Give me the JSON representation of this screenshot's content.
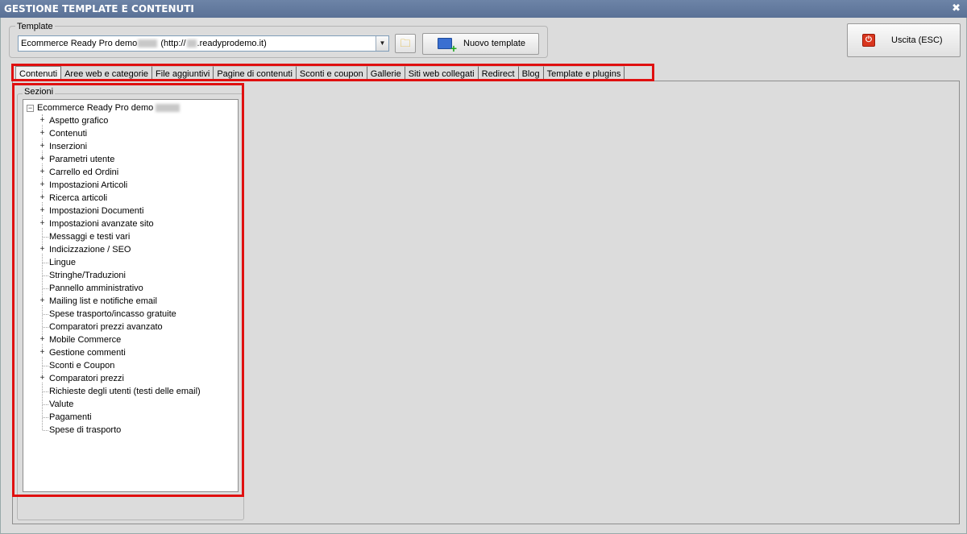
{
  "window": {
    "title": "GESTIONE TEMPLATE E CONTENUTI",
    "close_glyph": "✖"
  },
  "template": {
    "group_label": "Template",
    "selected_prefix": "Ecommerce Ready Pro demo",
    "selected_mid": "(http://",
    "selected_suffix": ".readyprodemo.it)",
    "new_button_label": "Nuovo template",
    "folder_icon": "folder-icon",
    "new_icon": "add-monitor-icon"
  },
  "exit": {
    "label": "Uscita (ESC)",
    "icon": "power-icon",
    "glyph": "⏻"
  },
  "tabs": [
    {
      "label": "Contenuti",
      "active": true
    },
    {
      "label": "Aree web e categorie"
    },
    {
      "label": "File aggiuntivi"
    },
    {
      "label": "Pagine di contenuti"
    },
    {
      "label": "Sconti e coupon"
    },
    {
      "label": "Gallerie"
    },
    {
      "label": "Siti web collegati"
    },
    {
      "label": "Redirect"
    },
    {
      "label": "Blog"
    },
    {
      "label": "Template e plugins"
    }
  ],
  "sections": {
    "label": "Sezioni",
    "root": "Ecommerce Ready Pro demo",
    "items": [
      {
        "label": "Aspetto grafico",
        "expandable": true
      },
      {
        "label": "Contenuti",
        "expandable": true
      },
      {
        "label": "Inserzioni",
        "expandable": true
      },
      {
        "label": "Parametri utente",
        "expandable": true
      },
      {
        "label": "Carrello ed Ordini",
        "expandable": true
      },
      {
        "label": "Impostazioni Articoli",
        "expandable": true
      },
      {
        "label": "Ricerca articoli",
        "expandable": true
      },
      {
        "label": "Impostazioni Documenti",
        "expandable": true
      },
      {
        "label": "Impostazioni avanzate sito",
        "expandable": true
      },
      {
        "label": "Messaggi e testi vari",
        "expandable": false
      },
      {
        "label": "Indicizzazione / SEO",
        "expandable": true
      },
      {
        "label": "Lingue",
        "expandable": false
      },
      {
        "label": "Stringhe/Traduzioni",
        "expandable": false
      },
      {
        "label": "Pannello amministrativo",
        "expandable": false
      },
      {
        "label": "Mailing list e notifiche email",
        "expandable": true
      },
      {
        "label": "Spese trasporto/incasso gratuite",
        "expandable": false
      },
      {
        "label": "Comparatori prezzi avanzato",
        "expandable": false
      },
      {
        "label": "Mobile Commerce",
        "expandable": true
      },
      {
        "label": "Gestione commenti",
        "expandable": true
      },
      {
        "label": "Sconti e Coupon",
        "expandable": false
      },
      {
        "label": "Comparatori prezzi",
        "expandable": true
      },
      {
        "label": "Richieste degli utenti (testi delle email)",
        "expandable": false
      },
      {
        "label": "Valute",
        "expandable": false
      },
      {
        "label": "Pagamenti",
        "expandable": false
      },
      {
        "label": "Spese di trasporto",
        "expandable": false
      }
    ]
  },
  "colors": {
    "titlebar": "#5f7699",
    "highlight": "#e01010",
    "background": "#dcdcdc"
  }
}
